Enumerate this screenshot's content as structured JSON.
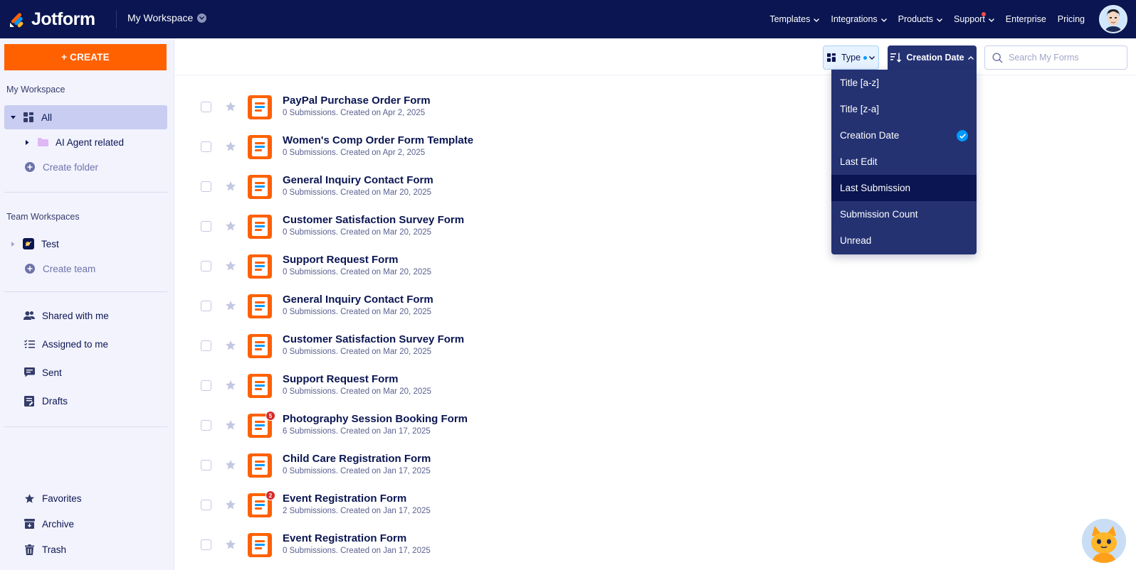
{
  "header": {
    "logo_text": "Jotform",
    "workspace_switch": "My Workspace",
    "nav": [
      {
        "label": "Templates",
        "has_dot": false
      },
      {
        "label": "Integrations",
        "has_dot": false
      },
      {
        "label": "Products",
        "has_dot": false
      },
      {
        "label": "Support",
        "has_dot": true
      },
      {
        "label": "Enterprise",
        "has_dot": false
      },
      {
        "label": "Pricing",
        "has_dot": false
      }
    ],
    "accent_color": "#0a1551"
  },
  "sidebar": {
    "create_label": "+ CREATE",
    "my_workspace_heading": "My Workspace",
    "all_label": "All",
    "folder_label": "AI Agent related",
    "create_folder_label": "Create folder",
    "team_heading": "Team Workspaces",
    "team_label": "Test",
    "create_team_label": "Create team",
    "shared_label": "Shared with me",
    "assigned_label": "Assigned to me",
    "sent_label": "Sent",
    "drafts_label": "Drafts",
    "favorites_label": "Favorites",
    "archive_label": "Archive",
    "trash_label": "Trash",
    "create_color": "#ff6100"
  },
  "toolbar": {
    "type_label": "Type",
    "sort_label": "Creation Date",
    "search_placeholder": "Search My Forms"
  },
  "sort_menu": {
    "items": [
      {
        "label": "Title [a-z]",
        "selected": false,
        "hovered": false
      },
      {
        "label": "Title [z-a]",
        "selected": false,
        "hovered": false
      },
      {
        "label": "Creation Date",
        "selected": true,
        "hovered": false
      },
      {
        "label": "Last Edit",
        "selected": false,
        "hovered": false
      },
      {
        "label": "Last Submission",
        "selected": false,
        "hovered": true
      },
      {
        "label": "Submission Count",
        "selected": false,
        "hovered": false
      },
      {
        "label": "Unread",
        "selected": false,
        "hovered": false
      }
    ]
  },
  "forms": [
    {
      "title": "PayPal Purchase Order Form",
      "meta": "0 Submissions. Created on Apr 2, 2025",
      "badge": ""
    },
    {
      "title": "Women's Comp Order Form Template",
      "meta": "0 Submissions. Created on Apr 2, 2025",
      "badge": ""
    },
    {
      "title": "General Inquiry Contact Form",
      "meta": "0 Submissions. Created on Mar 20, 2025",
      "badge": ""
    },
    {
      "title": "Customer Satisfaction Survey Form",
      "meta": "0 Submissions. Created on Mar 20, 2025",
      "badge": ""
    },
    {
      "title": "Support Request Form",
      "meta": "0 Submissions. Created on Mar 20, 2025",
      "badge": ""
    },
    {
      "title": "General Inquiry Contact Form",
      "meta": "0 Submissions. Created on Mar 20, 2025",
      "badge": ""
    },
    {
      "title": "Customer Satisfaction Survey Form",
      "meta": "0 Submissions. Created on Mar 20, 2025",
      "badge": ""
    },
    {
      "title": "Support Request Form",
      "meta": "0 Submissions. Created on Mar 20, 2025",
      "badge": ""
    },
    {
      "title": "Photography Session Booking Form",
      "meta": "6 Submissions. Created on Jan 17, 2025",
      "badge": "5"
    },
    {
      "title": "Child Care Registration Form",
      "meta": "0 Submissions. Created on Jan 17, 2025",
      "badge": ""
    },
    {
      "title": "Event Registration Form",
      "meta": "2 Submissions. Created on Jan 17, 2025",
      "badge": "2"
    },
    {
      "title": "Event Registration Form",
      "meta": "0 Submissions. Created on Jan 17, 2025",
      "badge": ""
    }
  ]
}
